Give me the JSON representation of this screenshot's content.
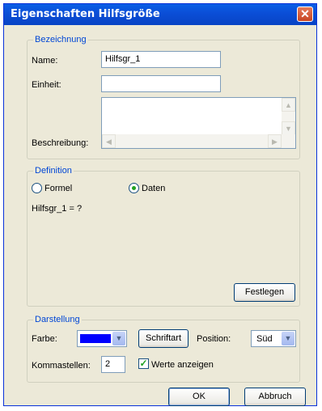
{
  "window": {
    "title": "Eigenschaften Hilfsgröße",
    "close_icon": "close-icon"
  },
  "bezeichnung": {
    "legend": "Bezeichnung",
    "name_label": "Name:",
    "name_value": "Hilfsgr_1",
    "einheit_label": "Einheit:",
    "einheit_value": "",
    "beschreibung_label": "Beschreibung:",
    "beschreibung_value": ""
  },
  "definition": {
    "legend": "Definition",
    "option_formel": "Formel",
    "option_daten": "Daten",
    "selected": "Daten",
    "expression": "Hilfsgr_1 = ?",
    "festlegen_label": "Festlegen"
  },
  "darstellung": {
    "legend": "Darstellung",
    "farbe_label": "Farbe:",
    "farbe_color": "#0000ff",
    "schriftart_label": "Schriftart",
    "position_label": "Position:",
    "position_value": "Süd",
    "kommastellen_label": "Kommastellen:",
    "kommastellen_value": "2",
    "werte_label": "Werte anzeigen",
    "werte_checked": true
  },
  "buttons": {
    "ok": "OK",
    "abbruch": "Abbruch"
  }
}
